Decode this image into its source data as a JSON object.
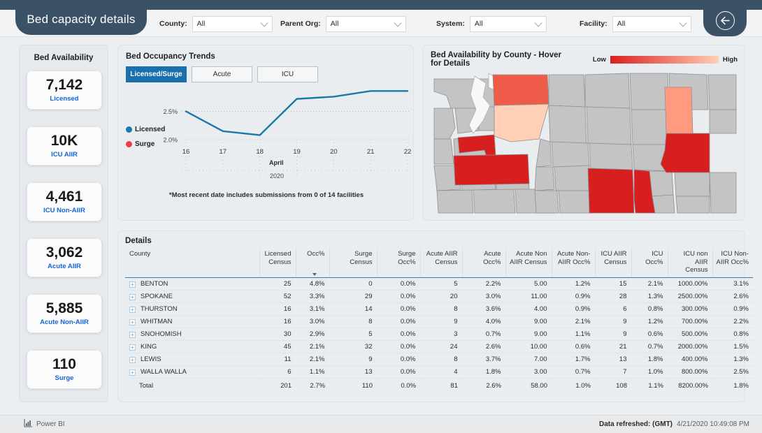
{
  "header": {
    "title": "Bed capacity details",
    "back_icon": "back-arrow-icon",
    "filters": [
      {
        "label": "County:",
        "value": "All"
      },
      {
        "label": "Parent Org:",
        "value": "All"
      },
      {
        "label": "System:",
        "value": "All"
      },
      {
        "label": "Facility:",
        "value": "All"
      }
    ]
  },
  "sidebar": {
    "title": "Bed Availability",
    "cards": [
      {
        "value": "7,142",
        "label": "Licensed"
      },
      {
        "value": "10K",
        "label": "ICU AIIR"
      },
      {
        "value": "4,461",
        "label": "ICU Non-AIIR"
      },
      {
        "value": "3,062",
        "label": "Acute AIIR"
      },
      {
        "value": "5,885",
        "label": "Acute Non-AIIR"
      },
      {
        "value": "110",
        "label": "Surge"
      }
    ]
  },
  "trend": {
    "title": "Bed Occupancy Trends",
    "tabs": [
      {
        "label": "Licensed/Surge",
        "active": true
      },
      {
        "label": "Acute",
        "active": false
      },
      {
        "label": "ICU",
        "active": false
      }
    ],
    "note": "*Most recent date includes submissions from 0 of 14 facilities",
    "axis_month": "April",
    "axis_year": "2020"
  },
  "map": {
    "title": "Bed Availability by County - Hover for Details",
    "legend_low": "Low",
    "legend_high": "High",
    "legend_low_color": "#d81f1f",
    "legend_high_color": "#ffd0b5"
  },
  "details": {
    "title": "Details",
    "columns": [
      "County",
      "Licensed Census",
      "Occ%",
      "Surge Census",
      "Surge Occ%",
      "Acute AIIR Census",
      "Acute Occ%",
      "Acute Non AIIR Census",
      "Acute Non-AIIR Occ%",
      "ICU AIIR Census",
      "ICU Occ%",
      "ICU non AIIR Census",
      "ICU Non-AIIR Occ%"
    ],
    "sorted_column": "Occ%",
    "rows": [
      {
        "county": "BENTON",
        "licensed_census": "25",
        "occ": "4.8%",
        "surge_census": "0",
        "surge_occ": "0.0%",
        "acute_aiir_census": "5",
        "acute_occ": "2.2%",
        "acute_non_aiir_census": "5.00",
        "acute_non_aiir_occ": "1.2%",
        "icu_aiir_census": "15",
        "icu_occ": "2.1%",
        "icu_non_aiir_census": "1000.00%",
        "icu_non_aiir_occ": "3.1%"
      },
      {
        "county": "SPOKANE",
        "licensed_census": "52",
        "occ": "3.3%",
        "surge_census": "29",
        "surge_occ": "0.0%",
        "acute_aiir_census": "20",
        "acute_occ": "3.0%",
        "acute_non_aiir_census": "11.00",
        "acute_non_aiir_occ": "0.9%",
        "icu_aiir_census": "28",
        "icu_occ": "1.3%",
        "icu_non_aiir_census": "2500.00%",
        "icu_non_aiir_occ": "2.6%"
      },
      {
        "county": "THURSTON",
        "licensed_census": "16",
        "occ": "3.1%",
        "surge_census": "14",
        "surge_occ": "0.0%",
        "acute_aiir_census": "8",
        "acute_occ": "3.6%",
        "acute_non_aiir_census": "4.00",
        "acute_non_aiir_occ": "0.9%",
        "icu_aiir_census": "6",
        "icu_occ": "0.8%",
        "icu_non_aiir_census": "300.00%",
        "icu_non_aiir_occ": "0.9%"
      },
      {
        "county": "WHITMAN",
        "licensed_census": "16",
        "occ": "3.0%",
        "surge_census": "8",
        "surge_occ": "0.0%",
        "acute_aiir_census": "9",
        "acute_occ": "4.0%",
        "acute_non_aiir_census": "9.00",
        "acute_non_aiir_occ": "2.1%",
        "icu_aiir_census": "9",
        "icu_occ": "1.2%",
        "icu_non_aiir_census": "700.00%",
        "icu_non_aiir_occ": "2.2%"
      },
      {
        "county": "SNOHOMISH",
        "licensed_census": "30",
        "occ": "2.9%",
        "surge_census": "5",
        "surge_occ": "0.0%",
        "acute_aiir_census": "3",
        "acute_occ": "0.7%",
        "acute_non_aiir_census": "9.00",
        "acute_non_aiir_occ": "1.1%",
        "icu_aiir_census": "9",
        "icu_occ": "0.6%",
        "icu_non_aiir_census": "500.00%",
        "icu_non_aiir_occ": "0.8%"
      },
      {
        "county": "KING",
        "licensed_census": "45",
        "occ": "2.1%",
        "surge_census": "32",
        "surge_occ": "0.0%",
        "acute_aiir_census": "24",
        "acute_occ": "2.6%",
        "acute_non_aiir_census": "10.00",
        "acute_non_aiir_occ": "0.6%",
        "icu_aiir_census": "21",
        "icu_occ": "0.7%",
        "icu_non_aiir_census": "2000.00%",
        "icu_non_aiir_occ": "1.5%"
      },
      {
        "county": "LEWIS",
        "licensed_census": "11",
        "occ": "2.1%",
        "surge_census": "9",
        "surge_occ": "0.0%",
        "acute_aiir_census": "8",
        "acute_occ": "3.7%",
        "acute_non_aiir_census": "7.00",
        "acute_non_aiir_occ": "1.7%",
        "icu_aiir_census": "13",
        "icu_occ": "1.8%",
        "icu_non_aiir_census": "400.00%",
        "icu_non_aiir_occ": "1.3%"
      },
      {
        "county": "WALLA WALLA",
        "licensed_census": "6",
        "occ": "1.1%",
        "surge_census": "13",
        "surge_occ": "0.0%",
        "acute_aiir_census": "4",
        "acute_occ": "1.8%",
        "acute_non_aiir_census": "3.00",
        "acute_non_aiir_occ": "0.7%",
        "icu_aiir_census": "7",
        "icu_occ": "1.0%",
        "icu_non_aiir_census": "800.00%",
        "icu_non_aiir_occ": "2.5%"
      }
    ],
    "total": {
      "county": "Total",
      "licensed_census": "201",
      "occ": "2.7%",
      "surge_census": "110",
      "surge_occ": "0.0%",
      "acute_aiir_census": "81",
      "acute_occ": "2.6%",
      "acute_non_aiir_census": "58.00",
      "acute_non_aiir_occ": "1.0%",
      "icu_aiir_census": "108",
      "icu_occ": "1.1%",
      "icu_non_aiir_census": "8200.00%",
      "icu_non_aiir_occ": "1.8%"
    }
  },
  "footer": {
    "brand": "Power BI",
    "brand_icon": "power-bi-icon",
    "refreshed_label": "Data refreshed: (GMT)",
    "refreshed_value": "4/21/2020 10:49:08 PM"
  },
  "chart_data": {
    "type": "line",
    "title": "Bed Occupancy Trends",
    "xlabel": "April 2020",
    "ylabel": "",
    "categories": [
      "16",
      "17",
      "18",
      "19",
      "20",
      "21",
      "22"
    ],
    "ylim": [
      1.95,
      2.95
    ],
    "yticks": [
      "2.0%",
      "2.5%"
    ],
    "ytick_values": [
      2.0,
      2.5
    ],
    "grid": true,
    "legend_position": "left",
    "series": [
      {
        "name": "Licensed",
        "color": "#1b77ad",
        "values": [
          2.5,
          2.15,
          2.08,
          2.72,
          2.76,
          2.86,
          2.86
        ]
      },
      {
        "name": "Surge",
        "color": "#ef3e42",
        "values": []
      }
    ],
    "annotation": "*Most recent date includes submissions from 0 of 14 facilities"
  }
}
